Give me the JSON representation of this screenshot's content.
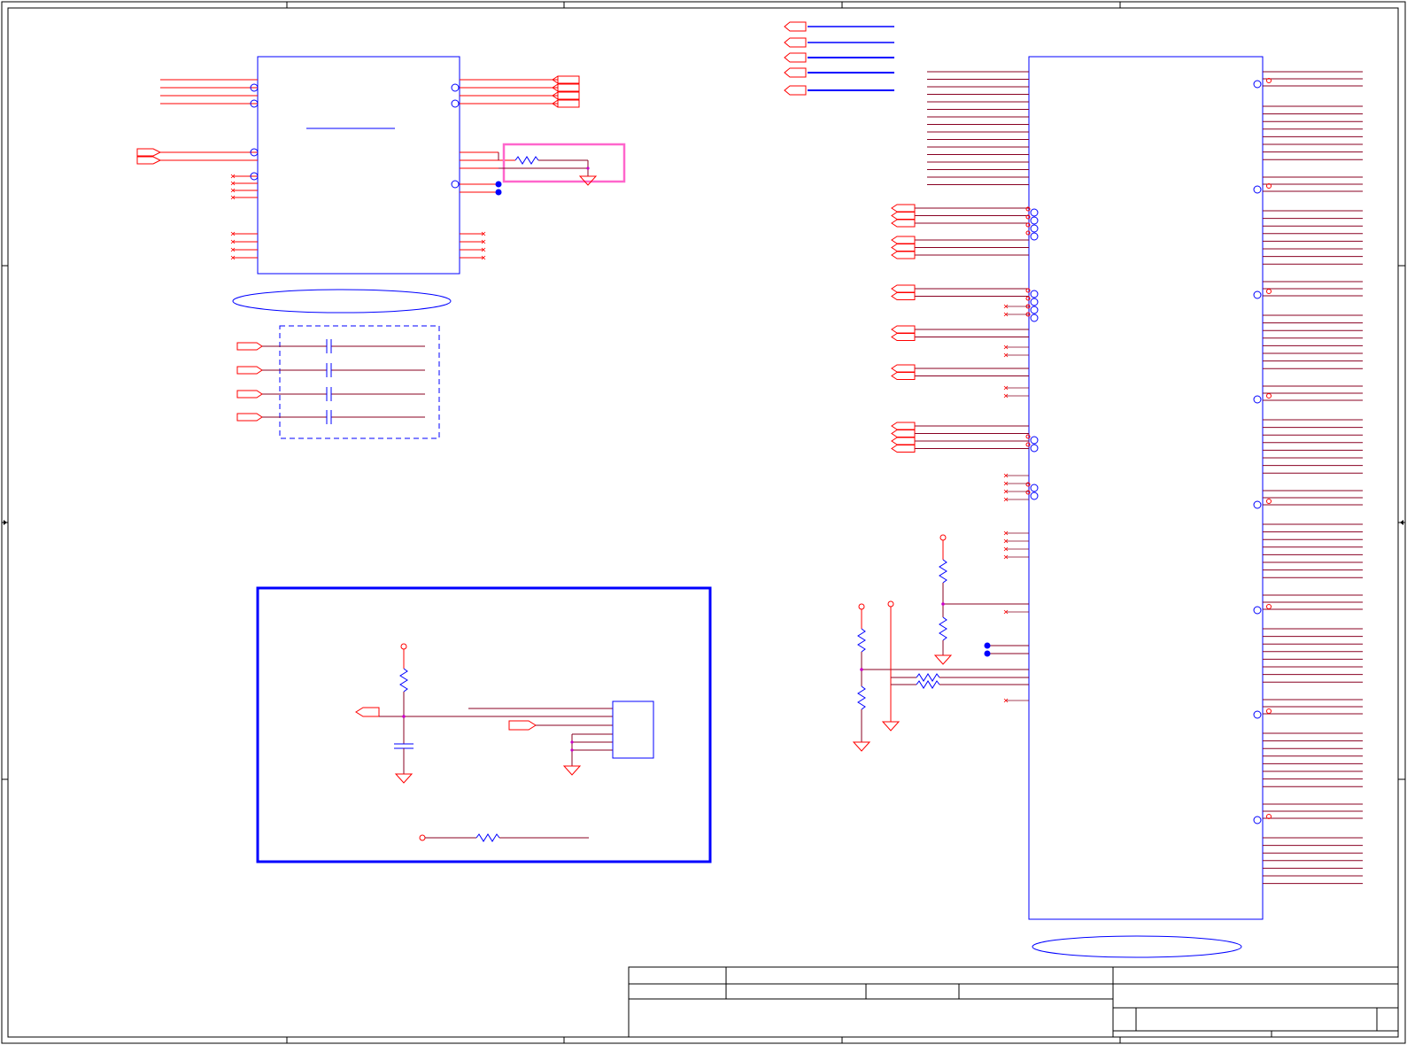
{
  "sheet": {
    "border_color": "#000000",
    "wire_color": "#ff0000",
    "component_color": "#0000ff",
    "net_color": "#880022",
    "highlight_color": "#ff66cc",
    "junction_color": "#cc00cc"
  },
  "title_block": {
    "title": "",
    "sheet_label": "",
    "date": "",
    "rev": ""
  }
}
